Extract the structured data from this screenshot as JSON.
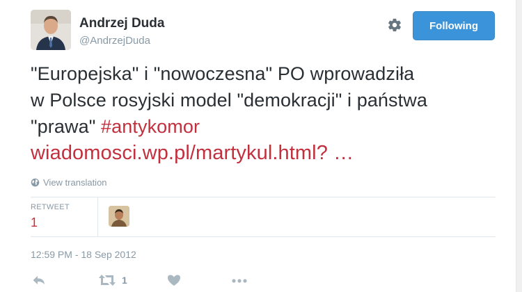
{
  "author": {
    "name": "Andrzej Duda",
    "handle": "@AndrzejDuda"
  },
  "follow_button": {
    "label": "Following"
  },
  "tweet": {
    "line1": "\"Europejska\" i \"nowoczesna\" PO wprowadziła",
    "line2": "w Polsce rosyjski model \"demokracji\" i państwa",
    "line3_text": "\"prawa\" ",
    "hashtag": "#antykomor",
    "link": "wiadomosci.wp.pl/martykul.html? …"
  },
  "translation": {
    "label": "View translation"
  },
  "stats": {
    "retweet_label": "RETWEET",
    "retweet_count": "1"
  },
  "timestamp": "12:59 PM - 18 Sep 2012",
  "actions": {
    "retweet_count": "1"
  },
  "icons": {
    "settings": "gear-icon",
    "globe": "globe-icon",
    "reply": "reply-icon",
    "retweet": "retweet-icon",
    "like": "heart-icon",
    "more": "more-icon"
  },
  "colors": {
    "accent": "#3b94d9",
    "link": "#c2303e",
    "muted": "#8899a6"
  }
}
